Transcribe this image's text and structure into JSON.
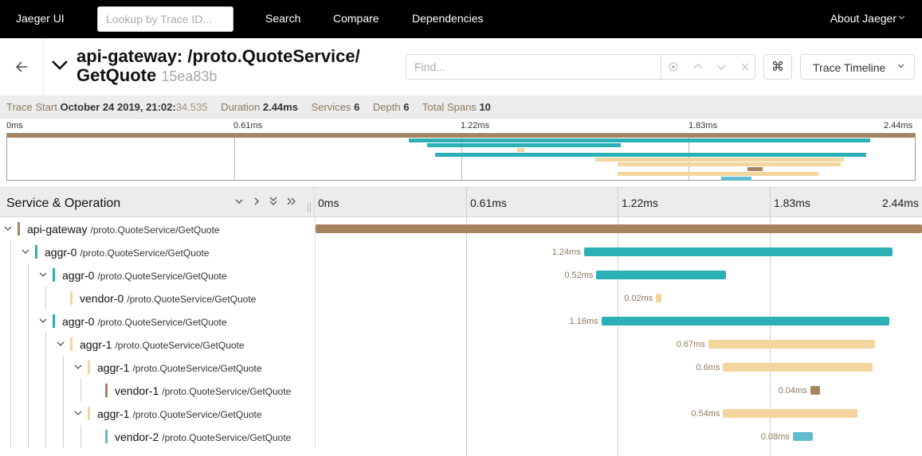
{
  "nav": {
    "brand": "Jaeger UI",
    "lookup_placeholder": "Lookup by Trace ID...",
    "links": [
      "Search",
      "Compare",
      "Dependencies"
    ],
    "about": "About Jaeger"
  },
  "header": {
    "title": "api-gateway: /proto.QuoteService/ GetQuote",
    "title_line1": "api-gateway: /proto.QuoteService/",
    "title_line2": "GetQuote",
    "trace_id": "15ea83b",
    "find_placeholder": "Find...",
    "cmd_icon": "⌘",
    "view_select": "Trace Timeline"
  },
  "summary": {
    "trace_start_label": "Trace Start",
    "trace_start_value": "October 24 2019, 21:02:",
    "trace_start_ms": "34.535",
    "duration_label": "Duration",
    "duration_value": "2.44ms",
    "services_label": "Services",
    "services_value": "6",
    "depth_label": "Depth",
    "depth_value": "6",
    "total_spans_label": "Total Spans",
    "total_spans_value": "10"
  },
  "ticks": [
    "0ms",
    "0.61ms",
    "1.22ms",
    "1.83ms",
    "2.44ms"
  ],
  "main": {
    "service_operation_label": "Service & Operation"
  },
  "colors": {
    "brown": "#a8835f",
    "teal": "#2ab0b5",
    "sand": "#f3d69d",
    "vendor1": "#a8835f",
    "vendor2": "#61bcd0"
  },
  "spans": [
    {
      "service": "api-gateway",
      "operation": "/proto.QuoteService/GetQuote",
      "depth": 0,
      "duration": "",
      "start": 0,
      "dur": 2.44,
      "color": "#a8835f",
      "toggle": true
    },
    {
      "service": "aggr-0",
      "operation": "/proto.QuoteService/GetQuote",
      "depth": 1,
      "duration": "1.24ms",
      "start": 1.08,
      "dur": 1.24,
      "color": "#2ab0b5",
      "toggle": true
    },
    {
      "service": "aggr-0",
      "operation": "/proto.QuoteService/GetQuote",
      "depth": 2,
      "duration": "0.52ms",
      "start": 1.13,
      "dur": 0.52,
      "color": "#2ab0b5",
      "toggle": true
    },
    {
      "service": "vendor-0",
      "operation": "/proto.QuoteService/GetQuote",
      "depth": 3,
      "duration": "0.02ms",
      "start": 1.37,
      "dur": 0.02,
      "color": "#f3d69d",
      "toggle": false
    },
    {
      "service": "aggr-0",
      "operation": "/proto.QuoteService/GetQuote",
      "depth": 2,
      "duration": "1.16ms",
      "start": 1.15,
      "dur": 1.16,
      "color": "#2ab0b5",
      "toggle": true
    },
    {
      "service": "aggr-1",
      "operation": "/proto.QuoteService/GetQuote",
      "depth": 3,
      "duration": "0.67ms",
      "start": 1.58,
      "dur": 0.67,
      "color": "#f3d69d",
      "toggle": true
    },
    {
      "service": "aggr-1",
      "operation": "/proto.QuoteService/GetQuote",
      "depth": 4,
      "duration": "0.6ms",
      "start": 1.64,
      "dur": 0.6,
      "color": "#f3d69d",
      "toggle": true
    },
    {
      "service": "vendor-1",
      "operation": "/proto.QuoteService/GetQuote",
      "depth": 5,
      "duration": "0.04ms",
      "start": 1.99,
      "dur": 0.04,
      "color": "#a8835f",
      "toggle": false
    },
    {
      "service": "aggr-1",
      "operation": "/proto.QuoteService/GetQuote",
      "depth": 4,
      "duration": "0.54ms",
      "start": 1.64,
      "dur": 0.54,
      "color": "#f3d69d",
      "toggle": true
    },
    {
      "service": "vendor-2",
      "operation": "/proto.QuoteService/GetQuote",
      "depth": 5,
      "duration": "0.08ms",
      "start": 1.92,
      "dur": 0.08,
      "color": "#61bcd0",
      "toggle": false
    }
  ]
}
